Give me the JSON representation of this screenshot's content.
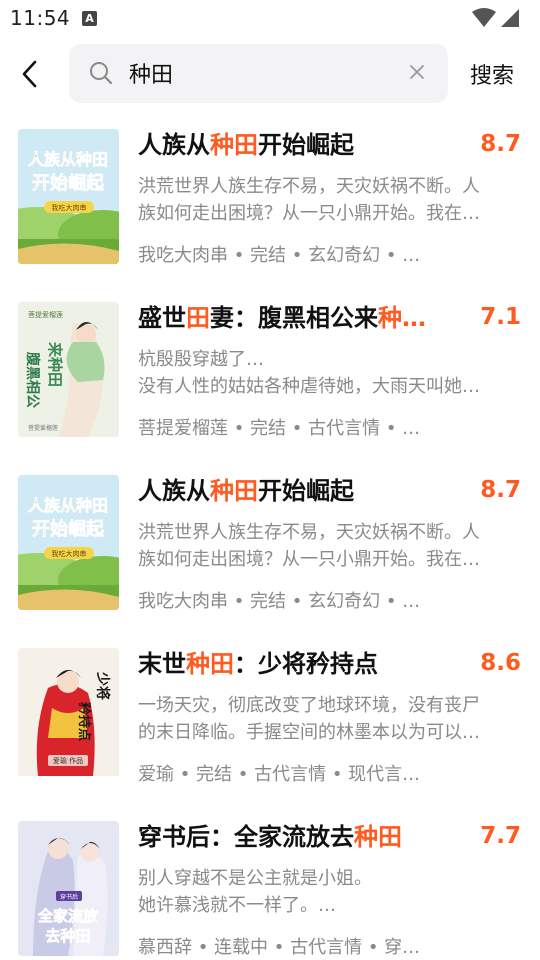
{
  "status": {
    "time": "11:54",
    "icon_a": "A"
  },
  "search": {
    "query": "种田",
    "button_label": "搜索"
  },
  "results": [
    {
      "title_parts": [
        "人族从",
        "种田",
        "开始崛起"
      ],
      "rating": "8.7",
      "desc_lines": [
        "洪荒世界人族生存不易，天灾妖祸不断。人",
        "族如何走出困境？从一只小鼎开始。我在…"
      ],
      "meta": "我吃大肉串 • 完结 • 玄幻奇幻 • …",
      "cover_text": [
        "人族从种田",
        "开始崛起",
        "我吃大肉串"
      ]
    },
    {
      "title_parts": [
        "盛世",
        "田",
        "妻：腹黑相公来",
        "种…"
      ],
      "rating": "7.1",
      "desc_lines": [
        "杭殷殷穿越了…",
        "没有人性的姑姑各种虐待她，大雨天叫她…"
      ],
      "meta": "菩提爱榴莲 • 完结 • 古代言情 • …",
      "cover_text": [
        "腹黑相公",
        "来种田",
        "菩提爱榴莲"
      ]
    },
    {
      "title_parts": [
        "人族从",
        "种田",
        "开始崛起"
      ],
      "rating": "8.7",
      "desc_lines": [
        "洪荒世界人族生存不易，天灾妖祸不断。人",
        "族如何走出困境？从一只小鼎开始。我在…"
      ],
      "meta": "我吃大肉串 • 完结 • 玄幻奇幻 • …",
      "cover_text": [
        "人族从种田",
        "开始崛起",
        "我吃大肉串"
      ]
    },
    {
      "title_parts": [
        "末世",
        "种田",
        "：少将矜持点"
      ],
      "rating": "8.6",
      "desc_lines": [
        "一场天灾，彻底改变了地球环境，没有丧尸",
        "的末日降临。手握空间的林墨本以为可以…"
      ],
      "meta": "爱瑜 • 完结 • 古代言情 • 现代言…",
      "cover_text": [
        "少将",
        "矜持点",
        "爱瑜 作品"
      ]
    },
    {
      "title_parts": [
        "穿书后：全家流放去",
        "种田",
        ""
      ],
      "rating": "7.7",
      "desc_lines": [
        "别人穿越不是公主就是小姐。",
        "她许慕浅就不一样了。…"
      ],
      "meta": "慕西辞 • 连载中 • 古代言情 • 穿…",
      "cover_text": [
        "全家流放",
        "去种田",
        "穿书后"
      ]
    }
  ]
}
